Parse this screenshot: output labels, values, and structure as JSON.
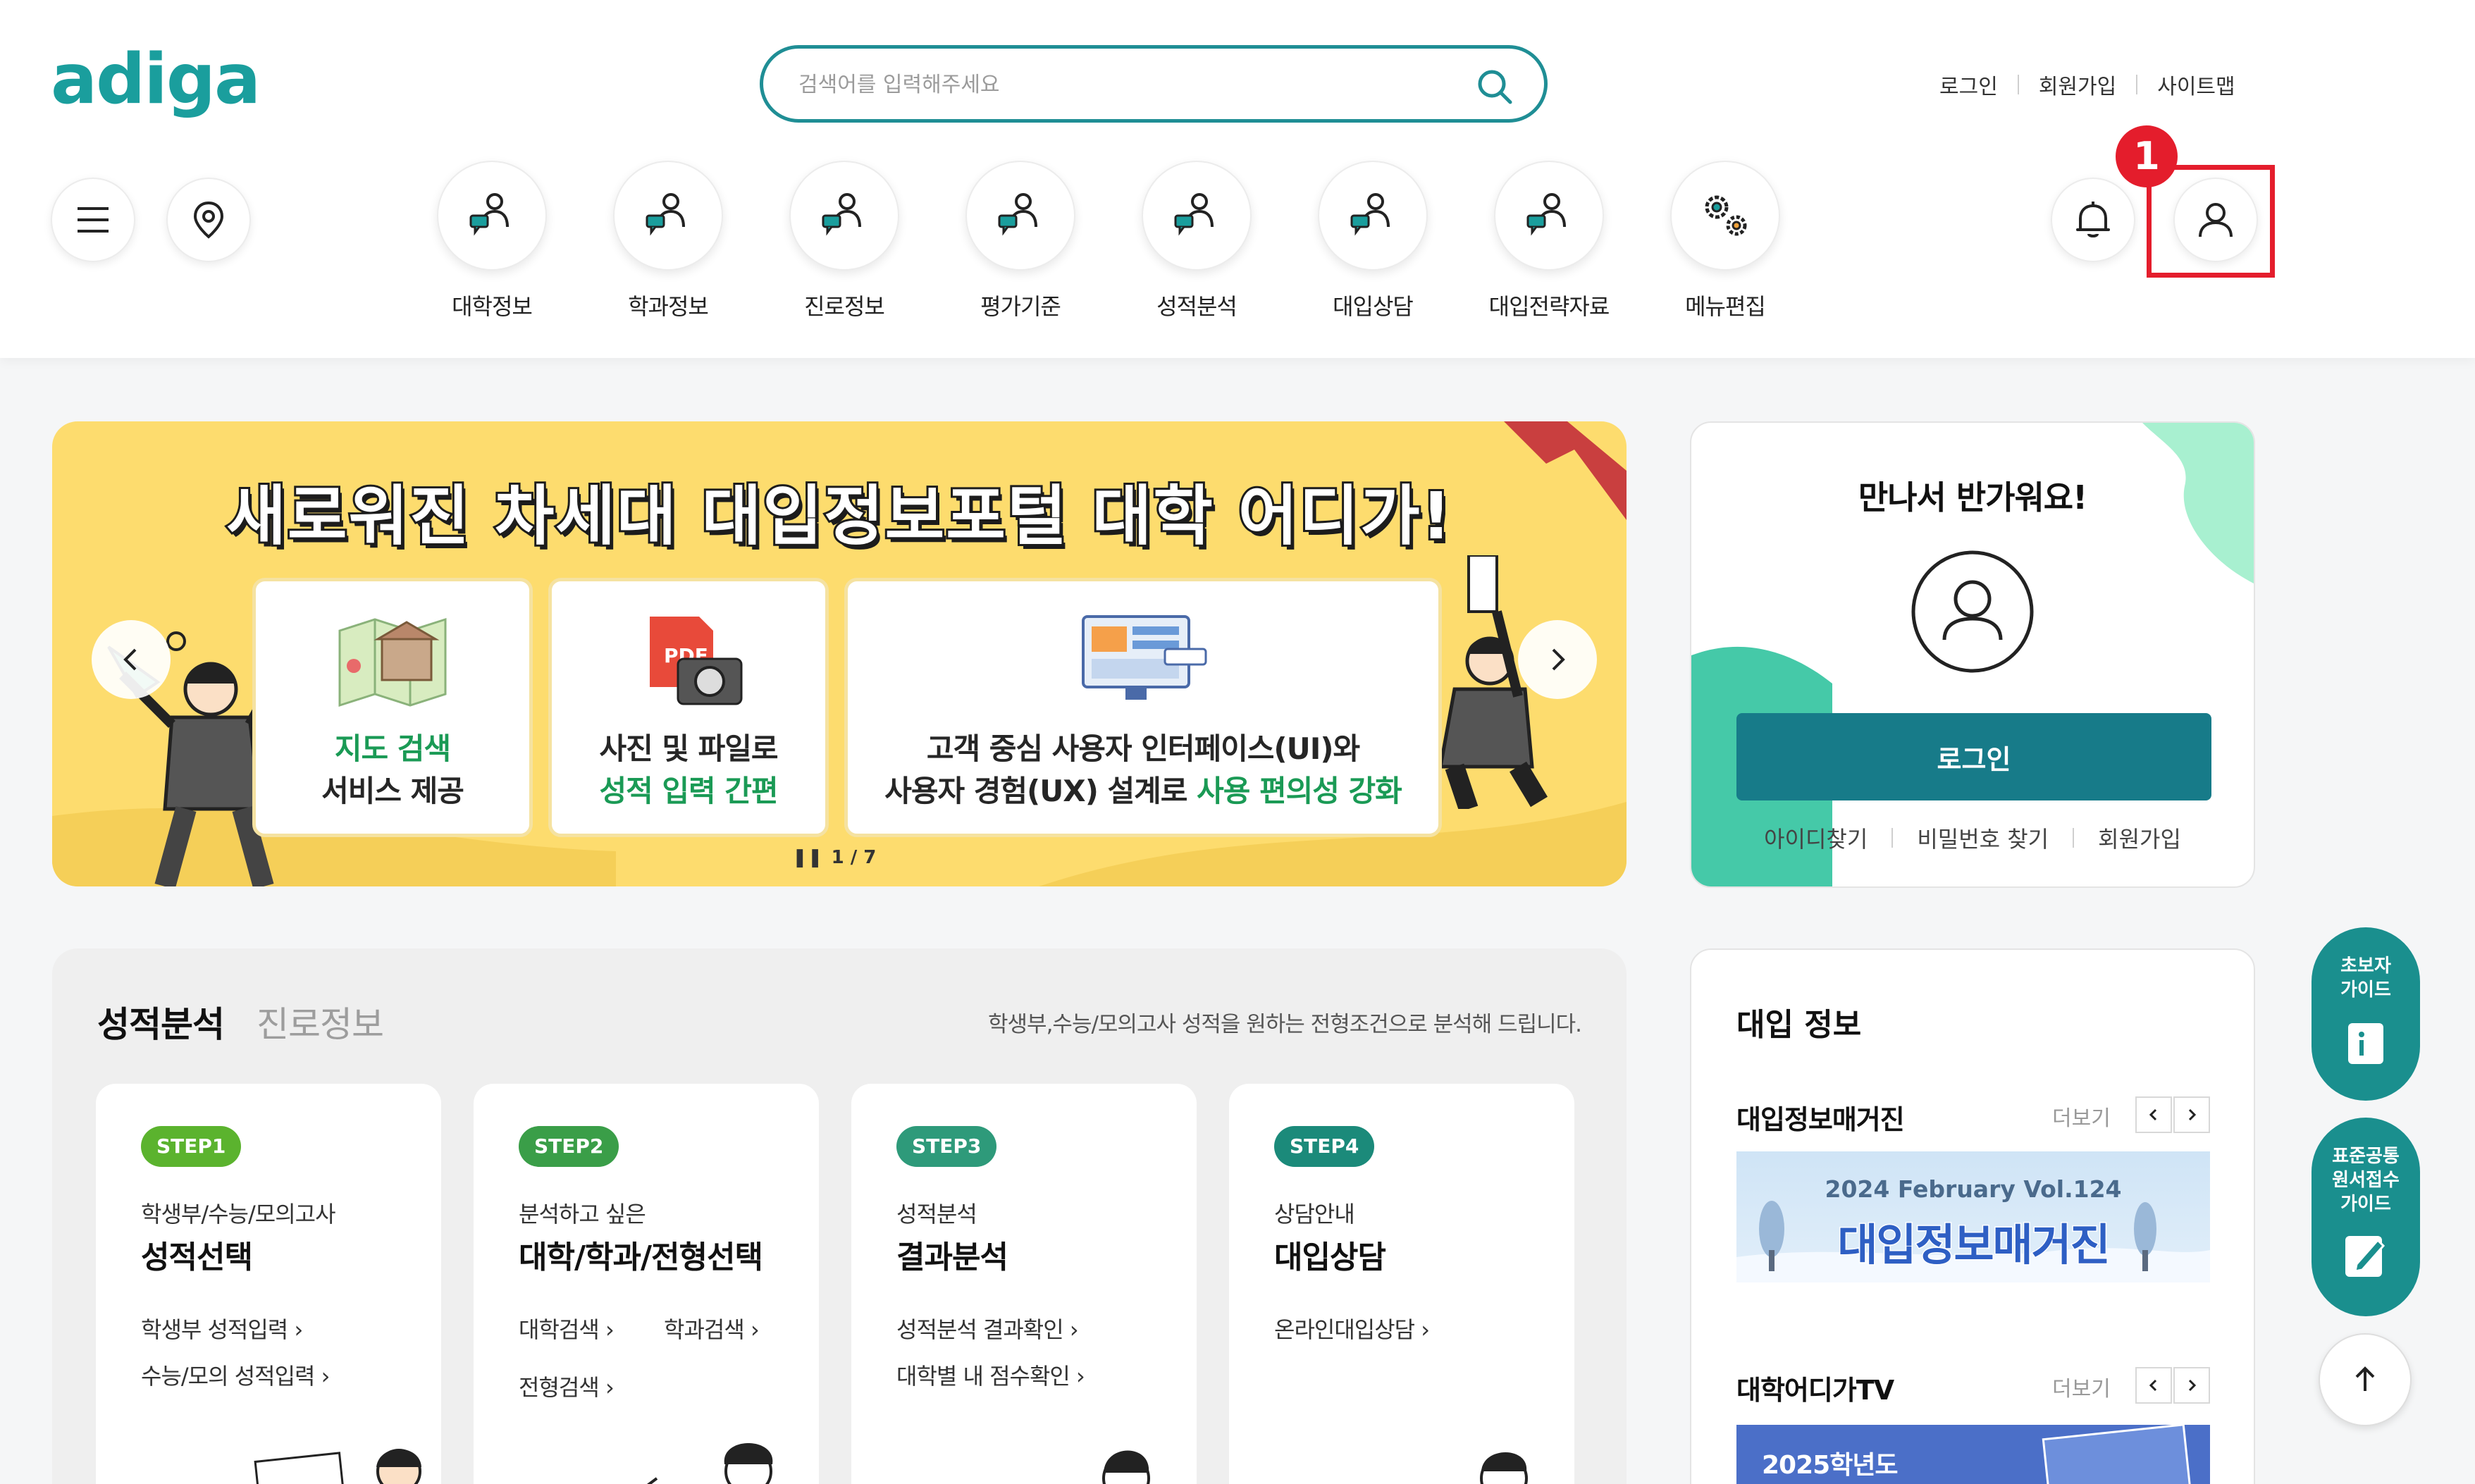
{
  "header": {
    "logo": "adiga",
    "search_placeholder": "검색어를 입력해주세요",
    "util_links": [
      "로그인",
      "회원가입",
      "사이트맵"
    ],
    "menu": [
      {
        "label": "대학정보",
        "icon": "person-chat-icon"
      },
      {
        "label": "학과정보",
        "icon": "person-chat-icon"
      },
      {
        "label": "진로정보",
        "icon": "person-chat-icon"
      },
      {
        "label": "평가기준",
        "icon": "person-chat-icon"
      },
      {
        "label": "성적분석",
        "icon": "person-chat-icon"
      },
      {
        "label": "대입상담",
        "icon": "person-chat-icon"
      },
      {
        "label": "대입전략자료",
        "icon": "person-chat-icon"
      },
      {
        "label": "메뉴편집",
        "icon": "gears-icon"
      }
    ],
    "annotation_badge": "1"
  },
  "banner": {
    "title": "새로워진 차세대 대입정보포털 대학 어디가!",
    "cards": [
      {
        "line1": "지도 검색",
        "line2": "서비스 제공",
        "icon": "map-icon"
      },
      {
        "line1": "사진 및 파일로",
        "line2": "성적 입력 간편",
        "icon": "pdf-camera-icon"
      },
      {
        "line1": "고객 중심 사용자 인터페이스(UI)와",
        "line2a": "사용자 경험(UX) 설계로 ",
        "line2b": "사용 편의성 강화",
        "icon": "monitor-ui-icon"
      }
    ],
    "pager": "1 / 7"
  },
  "login": {
    "greeting": "만나서 반가워요!",
    "button": "로그인",
    "links": [
      "아이디찾기",
      "비밀번호 찾기",
      "회원가입"
    ]
  },
  "analysis": {
    "tab_active": "성적분석",
    "tab_inactive": "진로정보",
    "description": "학생부,수능/모의고사 성적을 원하는 전형조건으로 분석해 드립니다.",
    "steps": [
      {
        "badge": "STEP1",
        "sub": "학생부/수능/모의고사",
        "title": "성적선택",
        "links": [
          "학생부 성적입력",
          "수능/모의 성적입력"
        ]
      },
      {
        "badge": "STEP2",
        "sub": "분석하고 싶은",
        "title": "대학/학과/전형선택",
        "links": [
          "대학검색",
          "학과검색",
          "전형검색"
        ]
      },
      {
        "badge": "STEP3",
        "sub": "성적분석",
        "title": "결과분석",
        "links": [
          "성적분석 결과확인",
          "대학별 내 점수확인"
        ]
      },
      {
        "badge": "STEP4",
        "sub": "상담안내",
        "title": "대입상담",
        "links": [
          "온라인대입상담"
        ]
      }
    ]
  },
  "info": {
    "title": "대입 정보",
    "magazine": {
      "label": "대입정보매거진",
      "more": "더보기",
      "issue": "2024 February Vol.124",
      "banner_title": "대입정보매거진"
    },
    "tv": {
      "label": "대학어디가TV",
      "more": "더보기",
      "banner_text": "2025학년도"
    }
  },
  "floating": {
    "beginner_guide": [
      "초보자",
      "가이드"
    ],
    "application_guide": [
      "표준공통",
      "원서접수",
      "가이드"
    ]
  },
  "colors": {
    "brand": "#1a9e9d",
    "primary_button": "#177b89",
    "banner_bg": "#fddc6e",
    "highlight": "#e41d2c"
  }
}
